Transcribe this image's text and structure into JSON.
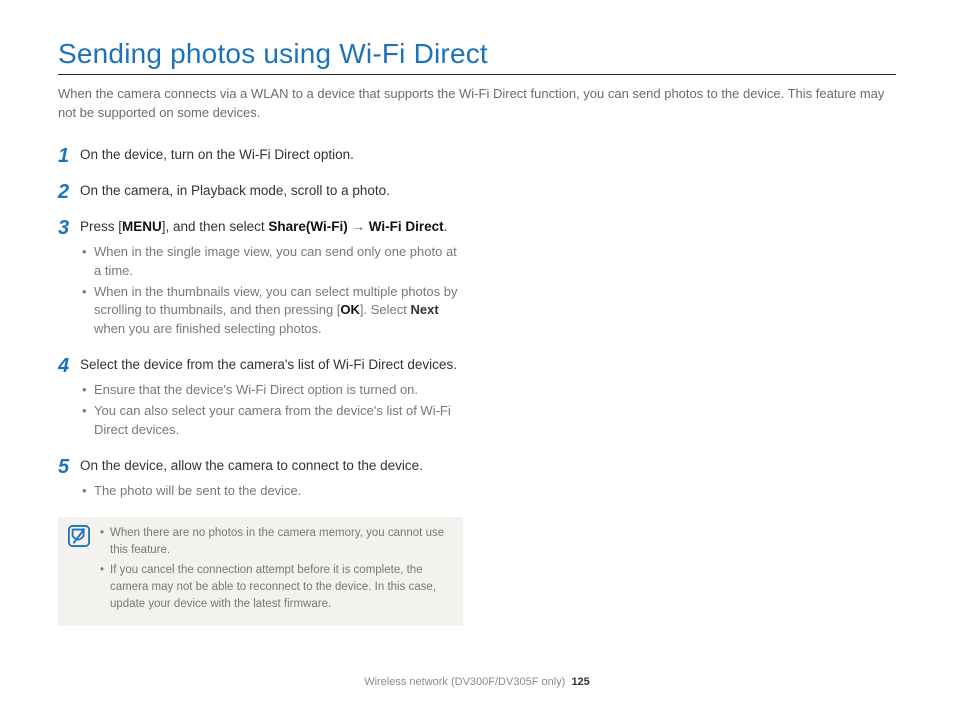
{
  "title": "Sending photos using Wi-Fi Direct",
  "intro": "When the camera connects via a WLAN to a device that supports the Wi-Fi Direct function, you can send photos to the device. This feature may not be supported on some devices.",
  "steps": {
    "s1": {
      "num": "1",
      "text": "On the device, turn on the Wi-Fi Direct option."
    },
    "s2": {
      "num": "2",
      "text": "On the camera, in Playback mode, scroll to a photo."
    },
    "s3": {
      "num": "3",
      "prefix": "Press [",
      "menu": "MENU",
      "mid": "], and then select ",
      "share": "Share(Wi-Fi)",
      "arrow": " → ",
      "wifidirect": "Wi-Fi Direct",
      "suffix": ".",
      "bul1": "When in the single image view, you can send only one photo at a time.",
      "bul2a": "When in the thumbnails view, you can select multiple photos by scrolling to thumbnails, and then pressing [",
      "ok": "OK",
      "bul2b": "]. Select ",
      "next": "Next",
      "bul2c": " when you are finished selecting photos."
    },
    "s4": {
      "num": "4",
      "text": "Select the device from the camera's list of Wi-Fi Direct devices.",
      "bul1": "Ensure that the device's Wi-Fi Direct option is turned on.",
      "bul2": "You can also select your camera from the device's list of Wi-Fi Direct devices."
    },
    "s5": {
      "num": "5",
      "text": "On the device, allow the camera to connect to the device.",
      "bul1": "The photo will be sent to the device."
    }
  },
  "notes": {
    "n1": "When there are no photos in the camera memory, you cannot use this feature.",
    "n2": "If you cancel the connection attempt before it is complete, the camera may not be able to reconnect to the device. In this case, update your device with the latest firmware."
  },
  "footer": {
    "section": "Wireless network (DV300F/DV305F only)",
    "page": "125"
  }
}
